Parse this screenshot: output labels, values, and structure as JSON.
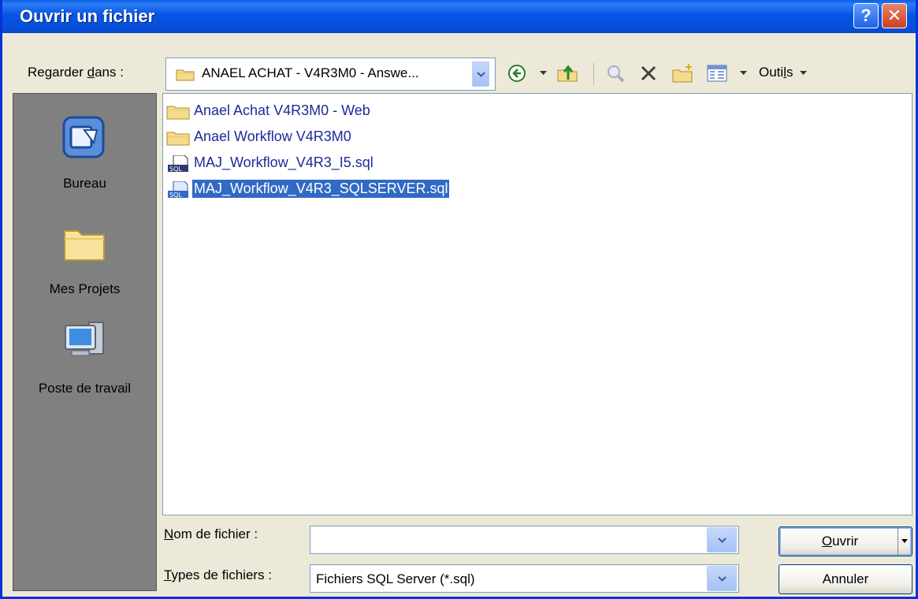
{
  "window": {
    "title": "Ouvrir un fichier",
    "help_label": "?",
    "close_label": "✕"
  },
  "lookin": {
    "label_pre": "Regarder ",
    "label_ul": "d",
    "label_post": "ans :",
    "value": "ANAEL ACHAT - V4R3M0 - Answe..."
  },
  "toolbar": {
    "outils_pre": "Outi",
    "outils_ul": "l",
    "outils_post": "s"
  },
  "places": [
    {
      "label": "Bureau",
      "icon": "desktop-icon"
    },
    {
      "label": "Mes Projets",
      "icon": "folder-icon"
    },
    {
      "label": "Poste de travail",
      "icon": "computer-icon"
    }
  ],
  "files": [
    {
      "name": "Anael Achat V4R3M0 - Web",
      "icon": "folder-icon",
      "selected": false
    },
    {
      "name": "Anael Workflow V4R3M0",
      "icon": "folder-icon",
      "selected": false
    },
    {
      "name": "MAJ_Workflow_V4R3_I5.sql",
      "icon": "sql-file-icon",
      "selected": false
    },
    {
      "name": "MAJ_Workflow_V4R3_SQLSERVER.sql",
      "icon": "sql-file-icon",
      "selected": true
    }
  ],
  "filename": {
    "label_ul": "N",
    "label_post": "om de fichier :",
    "value": ""
  },
  "filetype": {
    "label_ul": "T",
    "label_post": "ypes de fichiers :",
    "value": "Fichiers SQL Server (*.sql)"
  },
  "buttons": {
    "open_ul": "O",
    "open_post": "uvrir",
    "cancel": "Annuler"
  },
  "colors": {
    "title_bar": "#0754e5",
    "dialog_bg": "#ece9d8",
    "selection": "#316ac5",
    "file_text": "#1d2a9a"
  }
}
